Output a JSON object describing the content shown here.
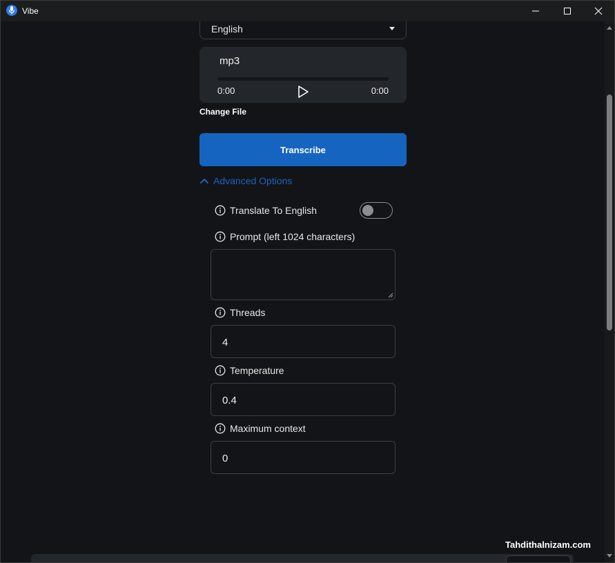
{
  "window": {
    "title": "Vibe",
    "accent": "#2f7ae5"
  },
  "titlebar": {
    "minimize_icon": "minimize-icon",
    "maximize_icon": "maximize-icon",
    "close_icon": "close-icon"
  },
  "language": {
    "selected": "English"
  },
  "player": {
    "file_name": "mp3",
    "current_time": "0:00",
    "duration": "0:00",
    "progress": 0
  },
  "change_file_label": "Change File",
  "transcribe": {
    "label": "Transcribe",
    "color": "#1565c0"
  },
  "advanced": {
    "label": "Advanced Options",
    "expanded": true,
    "color": "#1e63c0"
  },
  "options": {
    "translate": {
      "label": "Translate To English",
      "enabled": false
    },
    "prompt": {
      "label": "Prompt (left 1024 characters)",
      "value": ""
    },
    "threads": {
      "label": "Threads",
      "value": "4"
    },
    "temperature": {
      "label": "Temperature",
      "value": "0.4"
    },
    "max_context": {
      "label": "Maximum context",
      "value": "0"
    }
  },
  "watermark": "Tahdithalnizam.com"
}
